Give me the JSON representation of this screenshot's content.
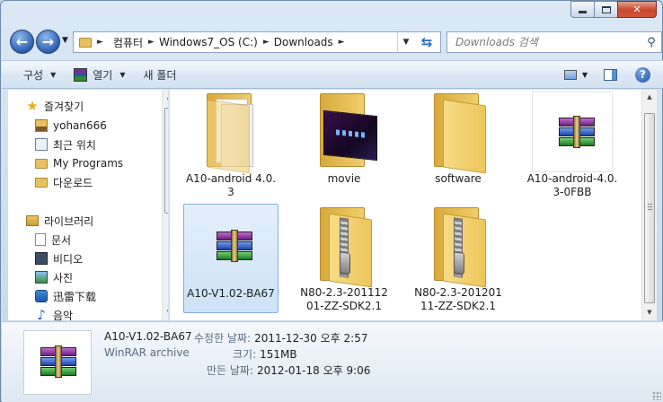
{
  "window": {
    "controls": {
      "minimize": "minimize",
      "maximize": "maximize",
      "close": "✕"
    }
  },
  "address": {
    "crumbs": [
      "컴퓨터",
      "Windows7_OS (C:)",
      "Downloads"
    ]
  },
  "search": {
    "placeholder": "Downloads 검색"
  },
  "toolbar": {
    "organize": "구성",
    "open_with": "열기",
    "new_folder": "새 폴더",
    "help": "?"
  },
  "nav": {
    "favorites_label": "즐겨찾기",
    "favorites": [
      "yohan666",
      "최근 위치",
      "My Programs",
      "다운로드"
    ],
    "libraries_label": "라이브러리",
    "libraries": [
      "문서",
      "비디오",
      "사진",
      "迅雷下载",
      "음악"
    ]
  },
  "files": [
    {
      "name": "A10-android 4.0.3",
      "kind": "folder-docs"
    },
    {
      "name": "movie",
      "kind": "folder-movie"
    },
    {
      "name": "software",
      "kind": "folder"
    },
    {
      "name": "A10-android-4.0.3-0FBB",
      "kind": "rar"
    },
    {
      "name": "A10-V1.02-BA67",
      "kind": "rar",
      "selected": true
    },
    {
      "name": "N80-2.3-20111201-ZZ-SDK2.1",
      "kind": "zip"
    },
    {
      "name": "N80-2.3-20120111-ZZ-SDK2.1",
      "kind": "zip"
    }
  ],
  "details": {
    "name": "A10-V1.02-BA67",
    "type": "WinRAR archive",
    "modified_label": "수정한 날짜:",
    "modified_value": "2011-12-30 오후 2:57",
    "size_label": "크기:",
    "size_value": "151MB",
    "created_label": "만든 날짜:",
    "created_value": "2012-01-18 오후 9:06"
  },
  "colors": {
    "accent": "#2d5fb0",
    "selection": "#cde2f8",
    "folder": "#eec55a"
  }
}
